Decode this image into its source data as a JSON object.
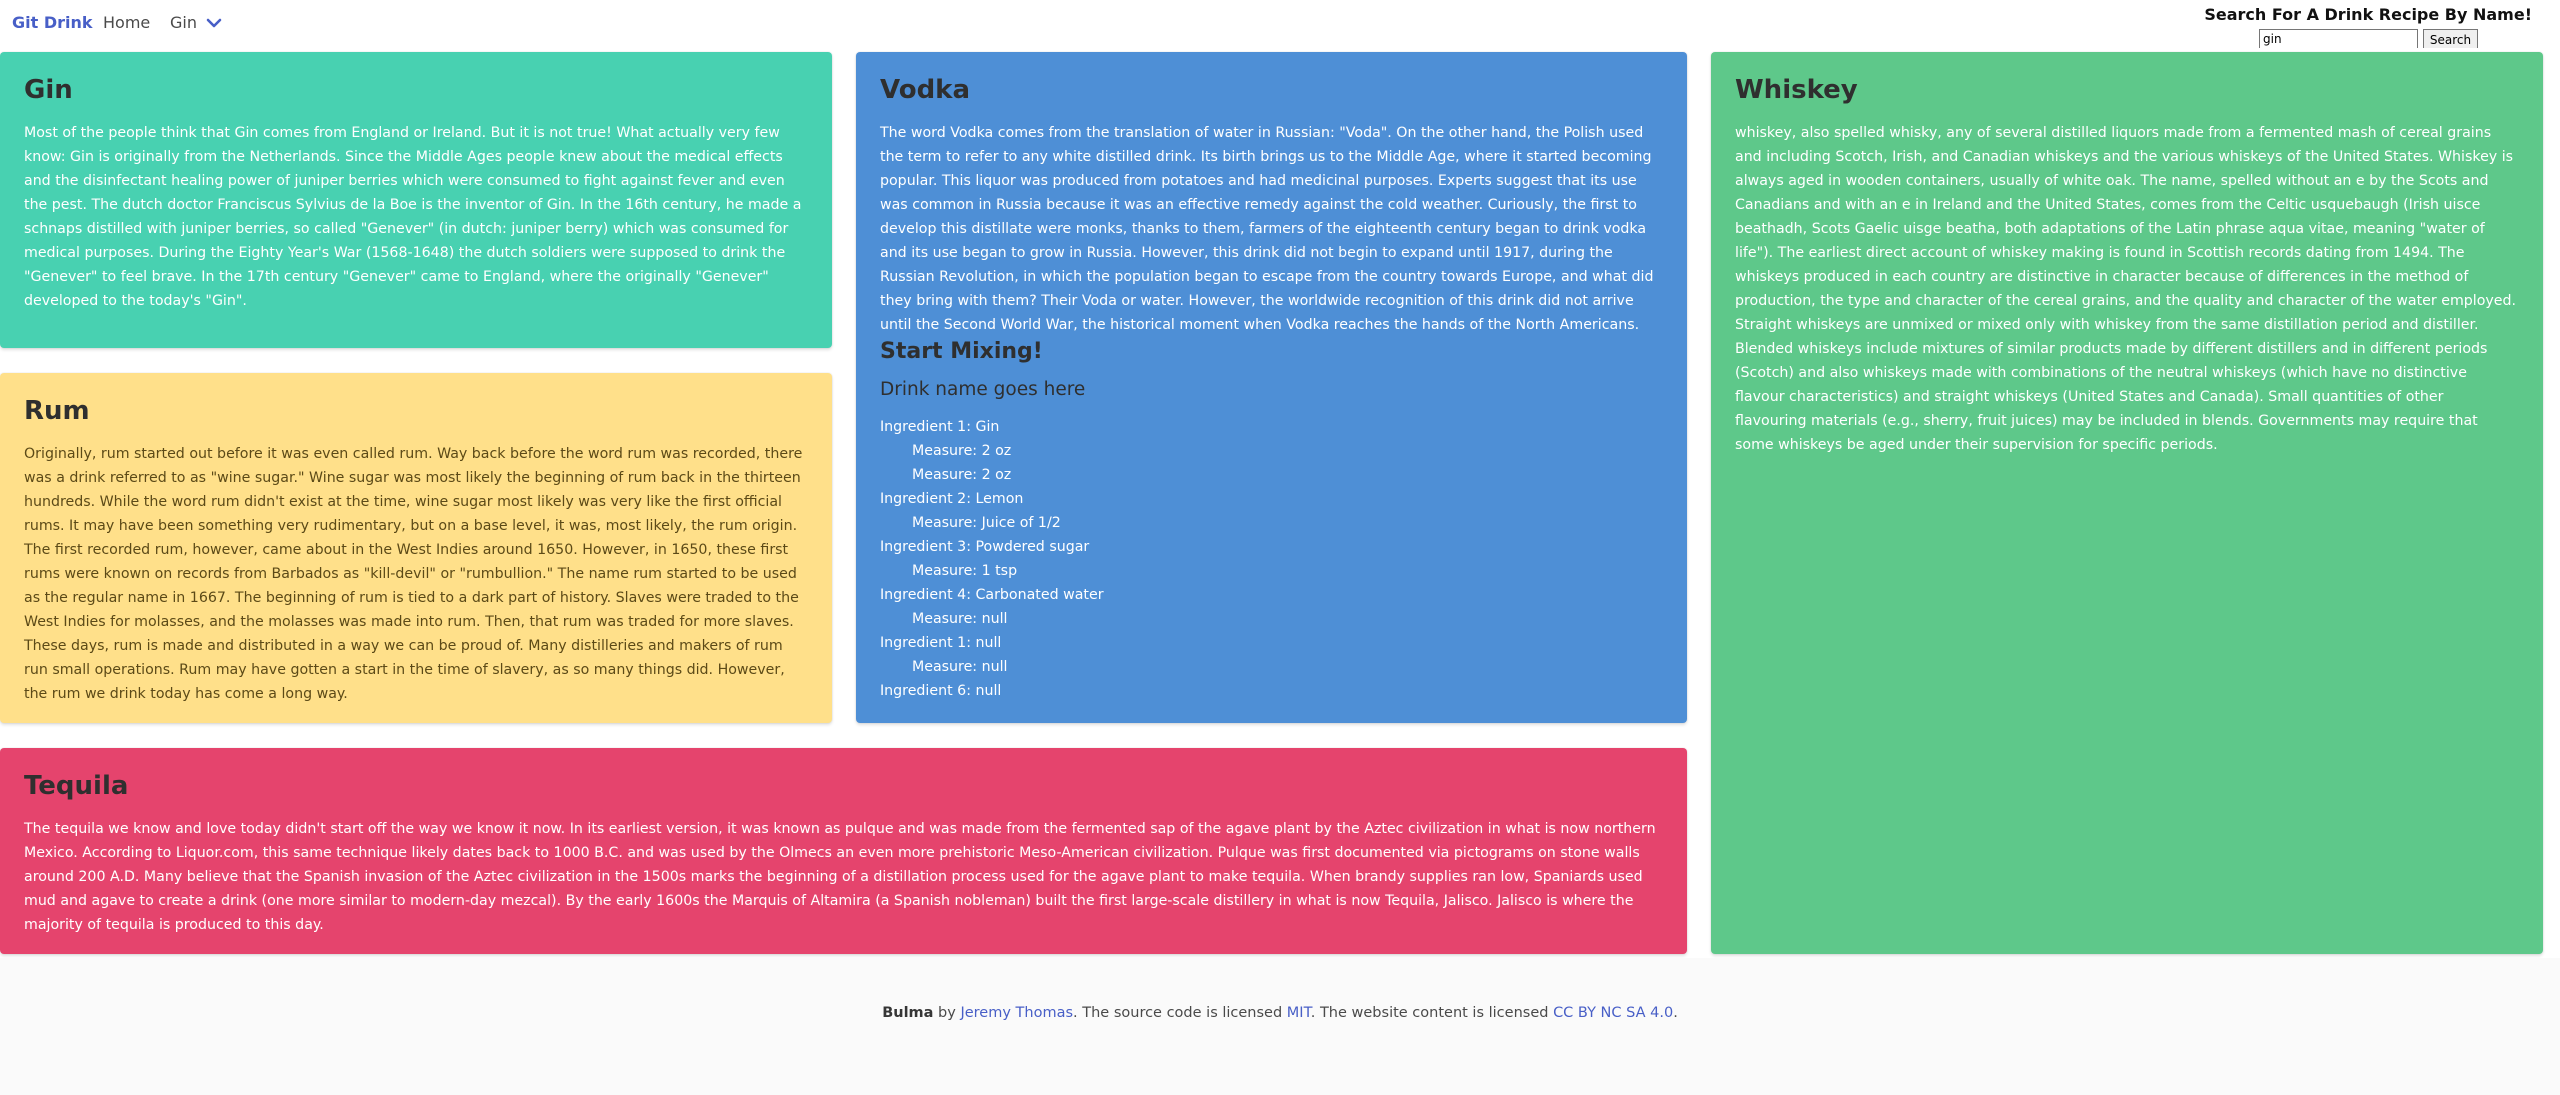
{
  "navbar": {
    "brand": "Git Drink",
    "home": "Home",
    "dropdown": "Gin",
    "search_title": "Search For A Drink Recipe By Name!",
    "search_value": "gin",
    "search_button": "Search"
  },
  "cards": {
    "gin": {
      "title": "Gin",
      "text": "Most of the people think that Gin comes from England or Ireland. But it is not true! What actually very few know: Gin is originally from the Netherlands. Since the Middle Ages people knew about the medical effects and the disinfectant healing power of juniper berries which were consumed to fight against fever and even the pest. The dutch doctor Franciscus Sylvius de la Boe is the inventor of Gin. In the 16th century, he made a schnaps distilled with juniper berries, so called \"Genever\" (in dutch: juniper berry) which was consumed for medical purposes. During the Eighty Year's War (1568-1648) the dutch soldiers were supposed to drink the \"Genever\" to feel brave. In the 17th century \"Genever\" came to England, where the originally \"Genever\" developed to the today's \"Gin\"."
    },
    "rum": {
      "title": "Rum",
      "text": "Originally, rum started out before it was even called rum. Way back before the word rum was recorded, there was a drink referred to as \"wine sugar.\" Wine sugar was most likely the beginning of rum back in the thirteen hundreds. While the word rum didn't exist at the time, wine sugar most likely was very like the first official rums. It may have been something very rudimentary, but on a base level, it was, most likely, the rum origin. The first recorded rum, however, came about in the West Indies around 1650. However, in 1650, these first rums were known on records from Barbados as \"kill-devil\" or \"rumbullion.\" The name rum started to be used as the regular name in 1667. The beginning of rum is tied to a dark part of history. Slaves were traded to the West Indies for molasses, and the molasses was made into rum. Then, that rum was traded for more slaves. These days, rum is made and distributed in a way we can be proud of. Many distilleries and makers of rum run small operations. Rum may have gotten a start in the time of slavery, as so many things did. However, the rum we drink today has come a long way."
    },
    "vodka": {
      "title": "Vodka",
      "text": "The word Vodka comes from the translation of water in Russian: \"Voda\". On the other hand, the Polish used the term to refer to any white distilled drink. Its birth brings us to the Middle Age, where it started becoming popular. This liquor was produced from potatoes and had medicinal purposes. Experts suggest that its use was common in Russia because it was an effective remedy against the cold weather. Curiously, the first to develop this distillate were monks, thanks to them, farmers of the eighteenth century began to drink vodka and its use began to grow in Russia. However, this drink did not begin to expand until 1917, during the Russian Revolution, in which the population began to escape from the country towards Europe, and what did they bring with them? Their Voda or water. However, the worldwide recognition of this drink did not arrive until the Second World War, the historical moment when Vodka reaches the hands of the North Americans.",
      "mix_title": "Start Mixing!",
      "drink_name": "Drink name goes here",
      "ingredients": [
        {
          "label": "Ingredient 1: Gin",
          "measure": "Measure: 2 oz"
        },
        {
          "label": "",
          "measure": "Measure: 2 oz"
        },
        {
          "label": "Ingredient 2: Lemon",
          "measure": "Measure: Juice of 1/2"
        },
        {
          "label": "Ingredient 3: Powdered sugar",
          "measure": "Measure: 1 tsp"
        },
        {
          "label": "Ingredient 4: Carbonated water",
          "measure": "Measure: null"
        },
        {
          "label": "Ingredient 1: null",
          "measure": "Measure: null"
        },
        {
          "label": "Ingredient 6: null",
          "measure": ""
        }
      ]
    },
    "whiskey": {
      "title": "Whiskey",
      "text": "whiskey, also spelled whisky, any of several distilled liquors made from a fermented mash of cereal grains and including Scotch, Irish, and Canadian whiskeys and the various whiskeys of the United States. Whiskey is always aged in wooden containers, usually of white oak. The name, spelled without an e by the Scots and Canadians and with an e in Ireland and the United States, comes from the Celtic usquebaugh (Irish uisce beathadh, Scots Gaelic uisge beatha, both adaptations of the Latin phrase aqua vitae, meaning \"water of life\"). The earliest direct account of whiskey making is found in Scottish records dating from 1494. The whiskeys produced in each country are distinctive in character because of differences in the method of production, the type and character of the cereal grains, and the quality and character of the water employed. Straight whiskeys are unmixed or mixed only with whiskey from the same distillation period and distiller. Blended whiskeys include mixtures of similar products made by different distillers and in different periods (Scotch) and also whiskeys made with combinations of the neutral whiskeys (which have no distinctive flavour characteristics) and straight whiskeys (United States and Canada). Small quantities of other flavouring materials (e.g., sherry, fruit juices) may be included in blends. Governments may require that some whiskeys be aged under their supervision for specific periods."
    },
    "tequila": {
      "title": "Tequila",
      "text": "The tequila we know and love today didn't start off the way we know it now. In its earliest version, it was known as pulque and was made from the fermented sap of the agave plant by the Aztec civilization in what is now northern Mexico. According to Liquor.com, this same technique likely dates back to 1000 B.C. and was used by the Olmecs an even more prehistoric Meso-American civilization. Pulque was first documented via pictograms on stone walls around 200 A.D. Many believe that the Spanish invasion of the Aztec civilization in the 1500s marks the beginning of a distillation process used for the agave plant to make tequila. When brandy supplies ran low, Spaniards used mud and agave to create a drink (one more similar to modern-day mezcal). By the early 1600s the Marquis of Altamira (a Spanish nobleman) built the first large-scale distillery in what is now Tequila, Jalisco. Jalisco is where the majority of tequila is produced to this day."
    }
  },
  "footer": {
    "bulma": "Bulma",
    "by": " by ",
    "author": "Jeremy Thomas",
    "mid": ". The source code is licensed ",
    "mit": "MIT",
    "mid2": ". The website content is licensed ",
    "cc": "CC BY NC SA 4.0",
    "end": "."
  }
}
